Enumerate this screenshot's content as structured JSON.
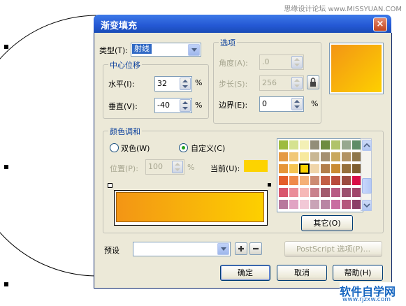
{
  "watermark": "思缘设计论坛 www.MISSYUAN.COM",
  "footer_logo": {
    "title": "软件自学网",
    "url": "www.rjzxw.com"
  },
  "dialog": {
    "title": "渐变填充",
    "close": "×",
    "type_label": "类型(T):",
    "type_value": "射线",
    "center": {
      "group": "中心位移",
      "h_label": "水平(I):",
      "h_value": "32",
      "v_label": "垂直(V):",
      "v_value": "-40",
      "unit": "%"
    },
    "options": {
      "group": "选项",
      "angle_label": "角度(A):",
      "angle_value": ".0",
      "steps_label": "步长(S):",
      "steps_value": "256",
      "edge_label": "边界(E):",
      "edge_value": "0",
      "unit": "%"
    },
    "color_blend": {
      "group": "颜色调和",
      "two_color": "双色(W)",
      "custom": "自定义(C)",
      "selected": "custom",
      "position_label": "位置(P):",
      "position_value": "100",
      "unit": "%",
      "current_label": "当前(U):",
      "current_color": "#fdd300",
      "gradient_from": "#f39515",
      "gradient_to": "#fdd000",
      "other_button": "其它(O)",
      "palette": [
        "#9dbb3f",
        "#d5e290",
        "#f3f0b5",
        "#938e78",
        "#6e8c41",
        "#b0c36a",
        "#97a98f",
        "#5e8d67",
        "#e59a44",
        "#f1c877",
        "#f7e99e",
        "#c9b793",
        "#a59071",
        "#c9a85e",
        "#b29363",
        "#8f774b",
        "#e69538",
        "#f5c451",
        "#fdd300",
        "#f0d5a9",
        "#b27e4b",
        "#c98b34",
        "#96703b",
        "#7e5e30",
        "#e45d2a",
        "#ef8a4b",
        "#f5b077",
        "#cd8b72",
        "#c25e46",
        "#b94a3d",
        "#9b4b40",
        "#d80e47",
        "#d9566d",
        "#ea8d99",
        "#f6b8b7",
        "#c9818c",
        "#a25a6d",
        "#b85b84",
        "#9c4f6e",
        "#a1466b",
        "#b8789c",
        "#e1a4c3",
        "#f2c8d6",
        "#c9a3b6",
        "#b985a4",
        "#c96ea1",
        "#b5567c",
        "#8c3f67"
      ]
    },
    "preset_label": "预设",
    "preset_value": "",
    "postscript_button": "PostScript 选项(P)...",
    "ok": "确定",
    "cancel": "取消",
    "help": "帮助(H)",
    "colors": {
      "title_bar": "#2458d4",
      "dialog_bg": "#ece9d8"
    }
  }
}
